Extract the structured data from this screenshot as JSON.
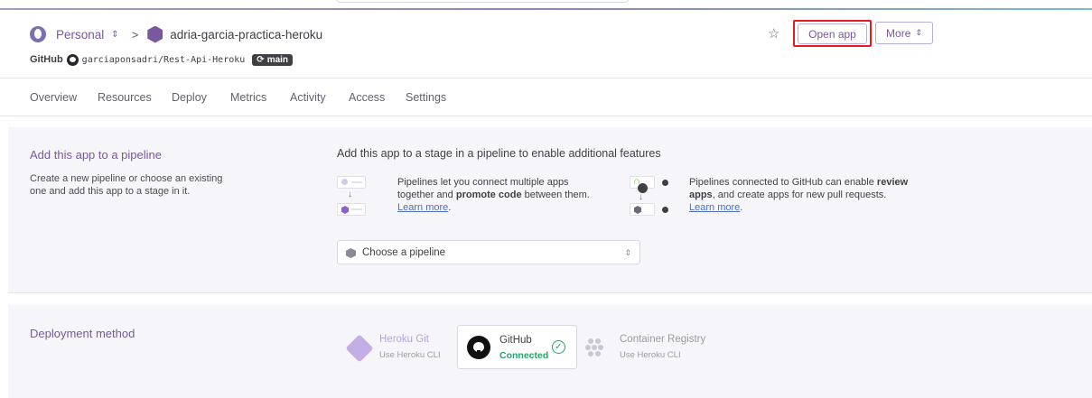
{
  "header": {
    "account_label": "Personal",
    "separator": ">",
    "app_name": "adria-garcia-practica-heroku",
    "github_label": "GitHub",
    "repo": "garciaponsadri/Rest-Api-Heroku",
    "branch": "main",
    "open_app_label": "Open app",
    "more_label": "More"
  },
  "tabs": [
    "Overview",
    "Resources",
    "Deploy",
    "Metrics",
    "Activity",
    "Access",
    "Settings"
  ],
  "pipeline": {
    "title": "Add this app to a pipeline",
    "desc_line1": "Create a new pipeline or choose an existing",
    "desc_line2": "one and add this app to a stage in it.",
    "intro": "Add this app to a stage in a pipeline to enable additional features",
    "feature1": {
      "line1": "Pipelines let you connect multiple apps",
      "line2_pre": "together and ",
      "line2_bold": "promote code",
      "line2_post": " between them.",
      "learn": "Learn more",
      "learn_suffix": "."
    },
    "feature2": {
      "line1_pre": "Pipelines connected to GitHub can enable ",
      "line1_bold": "review",
      "line2_bold": "apps",
      "line2_post": ", and create apps for new pull requests.",
      "learn": "Learn more",
      "learn_suffix": "."
    },
    "select_placeholder": "Choose a pipeline"
  },
  "deployment": {
    "title": "Deployment method",
    "methods": [
      {
        "name": "Heroku Git",
        "sub": "Use Heroku CLI"
      },
      {
        "name": "GitHub",
        "sub": "Connected"
      },
      {
        "name": "Container Registry",
        "sub": "Use Heroku CLI"
      }
    ]
  },
  "colors": {
    "accent": "#79589f",
    "focus_outline": "#e31b23",
    "connected": "#26a269"
  }
}
